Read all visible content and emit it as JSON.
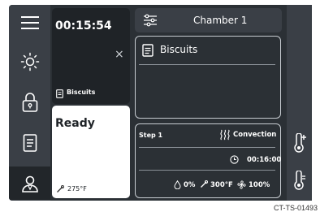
{
  "timer": {
    "value": "00:15:54",
    "close_glyph": "×"
  },
  "header": {
    "title": "Chamber 1"
  },
  "recipe": {
    "name": "Biscuits",
    "small_label": "Biscuits"
  },
  "status": {
    "text": "Ready",
    "probe_temp": "275°F"
  },
  "step": {
    "label": "Step 1",
    "mode": "Convection",
    "duration": "00:16:00",
    "humidity": "0%",
    "temperature": "300°F",
    "fan": "100%"
  },
  "sidebar": {
    "items": [
      {
        "icon": "menu-icon"
      },
      {
        "icon": "sun-icon"
      },
      {
        "icon": "lock-icon"
      },
      {
        "icon": "recipe-book-icon"
      },
      {
        "icon": "user-icon"
      }
    ]
  },
  "right_rail": {
    "items": [
      {
        "icon": "probe-add-icon"
      },
      {
        "icon": "probe-icon"
      }
    ]
  },
  "footer": {
    "code": "CT-TS-01493"
  },
  "colors": {
    "background": "#2b3035",
    "rail": "#3a3f46",
    "panel": "#1f2327",
    "outline": "#c7ccd1",
    "ready_panel": "#ffffff"
  }
}
